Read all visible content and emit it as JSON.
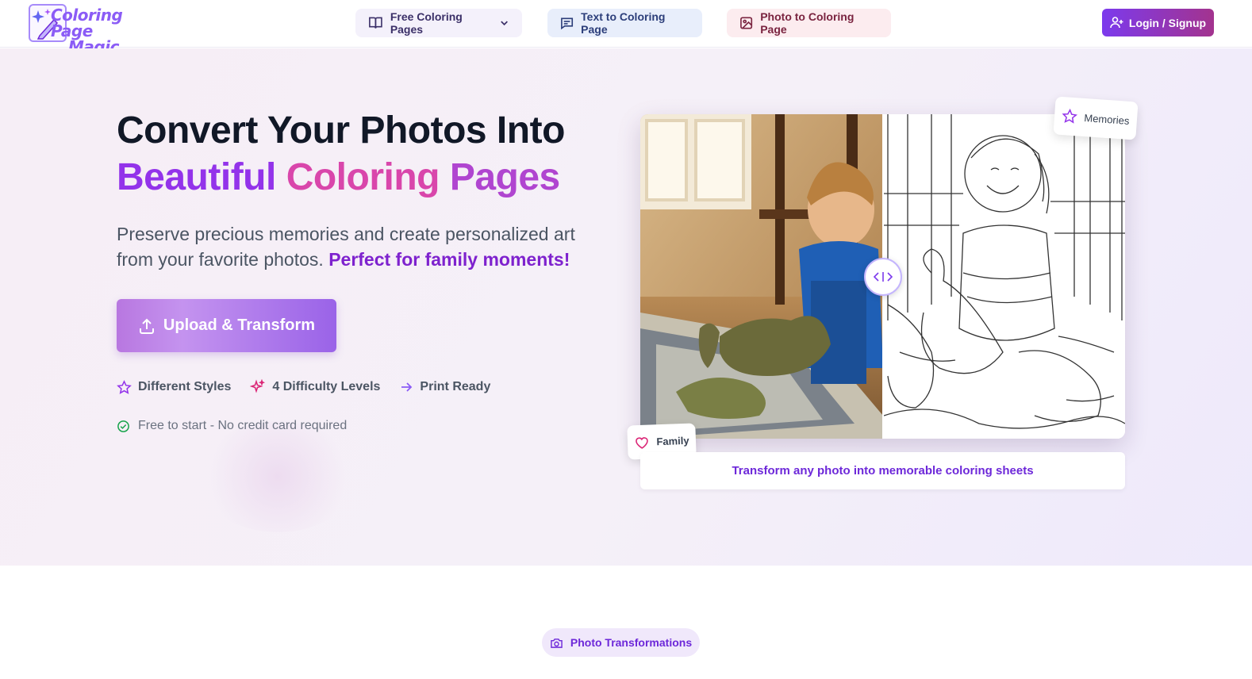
{
  "brand": {
    "name_line1": "Coloring Page",
    "name_line2": "Magic"
  },
  "nav": {
    "free_pages": "Free Coloring Pages",
    "text_to_page": "Text to Coloring Page",
    "photo_to_page": "Photo to Coloring Page",
    "login": "Login / Signup"
  },
  "hero": {
    "title_line1": "Convert Your Photos Into",
    "title_word1": "Beautiful",
    "title_word2": "Coloring",
    "title_word3": "Pages",
    "subtitle": "Preserve precious memories and create personalized art from your favorite photos.",
    "subtitle_highlight": "Perfect for family moments!",
    "cta": "Upload & Transform",
    "features": [
      "Different Styles",
      "4 Difficulty Levels",
      "Print Ready"
    ],
    "free_note": "Free to start - No credit card required"
  },
  "showcase": {
    "tag_top": "Memories",
    "tag_bottom": "Family",
    "caption": "Transform any photo into memorable coloring sheets"
  },
  "section": {
    "pill": "Photo Transformations"
  },
  "colors": {
    "accent": "#7c3aed",
    "pink": "#d946ab",
    "hero_bg": "#f6eef6"
  }
}
